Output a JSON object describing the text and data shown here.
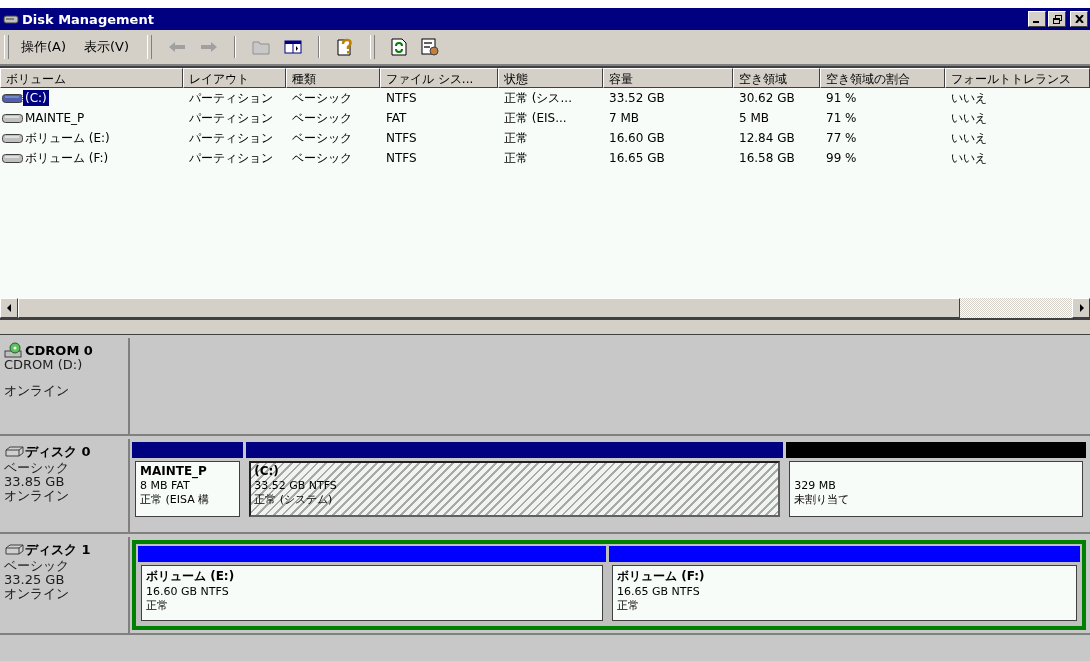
{
  "window": {
    "title": "Disk Management"
  },
  "menu": [
    "操作(A)",
    "表示(V)"
  ],
  "table": {
    "columns": [
      "ボリューム",
      "レイアウト",
      "種類",
      "ファイル シス...",
      "状態",
      "容量",
      "空き領域",
      "空き領域の割合",
      "フォールトトレランス"
    ],
    "rows": [
      {
        "selected": true,
        "cells": [
          "(C:)",
          "パーティション",
          "ベーシック",
          "NTFS",
          "正常 (シス...",
          "33.52 GB",
          "30.62 GB",
          "91 %",
          "いいえ"
        ]
      },
      {
        "selected": false,
        "cells": [
          "MAINTE_P",
          "パーティション",
          "ベーシック",
          "FAT",
          "正常 (EIS...",
          "7 MB",
          "5 MB",
          "71 %",
          "いいえ"
        ]
      },
      {
        "selected": false,
        "cells": [
          "ボリューム (E:)",
          "パーティション",
          "ベーシック",
          "NTFS",
          "正常",
          "16.60 GB",
          "12.84 GB",
          "77 %",
          "いいえ"
        ]
      },
      {
        "selected": false,
        "cells": [
          "ボリューム (F:)",
          "パーティション",
          "ベーシック",
          "NTFS",
          "正常",
          "16.65 GB",
          "16.58 GB",
          "99 %",
          "いいえ"
        ]
      }
    ]
  },
  "disks": [
    {
      "kind": "cdrom",
      "name": "CDROM 0",
      "lines": [
        "CDROM (D:)",
        "オンライン"
      ]
    },
    {
      "kind": "disk",
      "name": "ディスク 0",
      "lines": [
        "ベーシック",
        "33.85 GB",
        "オンライン"
      ],
      "partitions": [
        {
          "kind": "primary",
          "selected": false,
          "name": "MAINTE_P",
          "lines": [
            "8 MB FAT",
            "正常 (EISA 構"
          ]
        },
        {
          "kind": "primary",
          "selected": true,
          "name": "(C:)",
          "lines": [
            "33.52 GB NTFS",
            "正常 (システム)"
          ]
        },
        {
          "kind": "unallocated",
          "selected": false,
          "lines": [
            "329 MB",
            "未割り当て"
          ]
        }
      ]
    },
    {
      "kind": "disk",
      "name": "ディスク 1",
      "lines": [
        "ベーシック",
        "33.25 GB",
        "オンライン"
      ],
      "extended": true,
      "partitions": [
        {
          "kind": "logical",
          "selected": false,
          "name": "ボリューム (E:)",
          "lines": [
            "16.60 GB NTFS",
            "正常"
          ]
        },
        {
          "kind": "logical",
          "selected": false,
          "name": "ボリューム (F:)",
          "lines": [
            "16.65 GB NTFS",
            "正常"
          ]
        }
      ]
    }
  ]
}
